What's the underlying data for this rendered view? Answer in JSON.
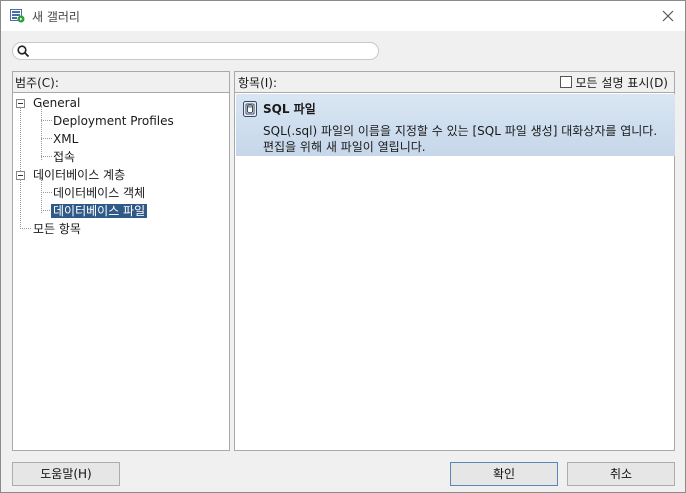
{
  "window": {
    "title": "새 갤러리"
  },
  "search": {
    "placeholder": "",
    "value": ""
  },
  "left_pane": {
    "label": "범주(C):",
    "tree": [
      {
        "label": "General",
        "level": 0,
        "expanded": true
      },
      {
        "label": "Deployment Profiles",
        "level": 1
      },
      {
        "label": "XML",
        "level": 1
      },
      {
        "label": "접속",
        "level": 1
      },
      {
        "label": "데이터베이스 계층",
        "level": 0,
        "expanded": true
      },
      {
        "label": "데이터베이스 객체",
        "level": 1
      },
      {
        "label": "데이터베이스 파일",
        "level": 1,
        "selected": true
      },
      {
        "label": "모든 항목",
        "level": 0
      }
    ]
  },
  "right_pane": {
    "label": "항목(I):",
    "show_all_desc_label": "모든 설명 표시(D)",
    "show_all_desc_checked": false,
    "items": [
      {
        "title": "SQL 파일",
        "description": "SQL(.sql) 파일의 이름을 지정할 수 있는 [SQL 파일 생성] 대화상자를 엽니다. 편집을 위해 새 파일이 열립니다.",
        "selected": true,
        "icon": "sql-file-icon"
      }
    ]
  },
  "buttons": {
    "help": "도움말(H)",
    "ok": "확인",
    "cancel": "취소"
  },
  "colors": {
    "selection": "#2f5a88",
    "item_highlight": "#c6d7ea"
  }
}
